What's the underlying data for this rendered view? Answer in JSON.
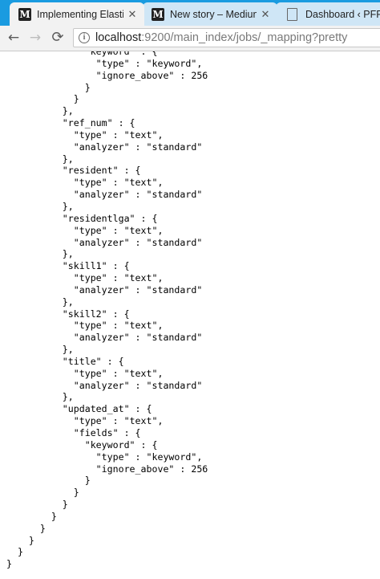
{
  "tabs": [
    {
      "title": "Implementing Elasti",
      "icon": "medium-m-icon",
      "active": true
    },
    {
      "title": "New story – Mediun",
      "icon": "medium-m-icon",
      "active": false
    },
    {
      "title": "Dashboard ‹ PFPEI",
      "icon": "page-icon",
      "active": false
    }
  ],
  "favicon_letter": "M",
  "toolbar": {
    "back_icon": "←",
    "forward_icon": "→",
    "reload_icon": "⟳",
    "info_icon": "i",
    "url_host": "localhost",
    "url_path": ":9200/main_index/jobs/_mapping?pretty"
  },
  "json_lines": [
    "              \"keyword\" : {",
    "                \"type\" : \"keyword\",",
    "                \"ignore_above\" : 256",
    "              }",
    "            }",
    "          },",
    "          \"ref_num\" : {",
    "            \"type\" : \"text\",",
    "            \"analyzer\" : \"standard\"",
    "          },",
    "          \"resident\" : {",
    "            \"type\" : \"text\",",
    "            \"analyzer\" : \"standard\"",
    "          },",
    "          \"residentlga\" : {",
    "            \"type\" : \"text\",",
    "            \"analyzer\" : \"standard\"",
    "          },",
    "          \"skill1\" : {",
    "            \"type\" : \"text\",",
    "            \"analyzer\" : \"standard\"",
    "          },",
    "          \"skill2\" : {",
    "            \"type\" : \"text\",",
    "            \"analyzer\" : \"standard\"",
    "          },",
    "          \"title\" : {",
    "            \"type\" : \"text\",",
    "            \"analyzer\" : \"standard\"",
    "          },",
    "          \"updated_at\" : {",
    "            \"type\" : \"text\",",
    "            \"fields\" : {",
    "              \"keyword\" : {",
    "                \"type\" : \"keyword\",",
    "                \"ignore_above\" : 256",
    "              }",
    "            }",
    "          }",
    "        }",
    "      }",
    "    }",
    "  }",
    "}"
  ]
}
